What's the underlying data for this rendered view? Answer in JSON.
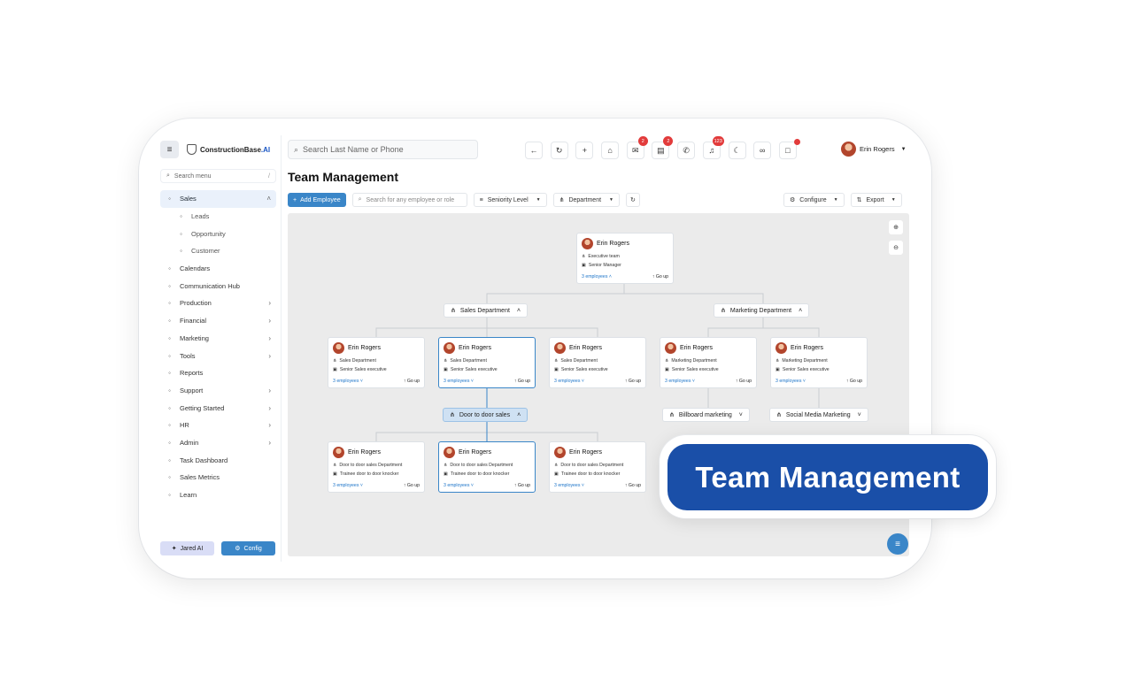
{
  "app": {
    "logo_text": "ConstructionBase",
    "logo_suffix": ".AI"
  },
  "sidebar": {
    "search_placeholder": "Search menu",
    "search_hint": "/",
    "items": [
      {
        "label": "Sales",
        "icon": "sales-icon",
        "active": true,
        "expanded": true
      },
      {
        "label": "Leads",
        "icon": "leads-icon",
        "sub": true
      },
      {
        "label": "Opportunity",
        "icon": "opportunity-icon",
        "sub": true
      },
      {
        "label": "Customer",
        "icon": "customer-icon",
        "sub": true
      },
      {
        "label": "Calendars",
        "icon": "calendar-icon"
      },
      {
        "label": "Communication Hub",
        "icon": "chat-icon"
      },
      {
        "label": "Production",
        "icon": "production-icon",
        "chevron": true
      },
      {
        "label": "Financial",
        "icon": "financial-icon",
        "chevron": true
      },
      {
        "label": "Marketing",
        "icon": "marketing-icon",
        "chevron": true
      },
      {
        "label": "Tools",
        "icon": "tools-icon",
        "chevron": true
      },
      {
        "label": "Reports",
        "icon": "reports-icon"
      },
      {
        "label": "Support",
        "icon": "support-icon",
        "chevron": true
      },
      {
        "label": "Getting Started",
        "icon": "rocket-icon",
        "chevron": true
      },
      {
        "label": "HR",
        "icon": "hr-icon",
        "chevron": true
      },
      {
        "label": "Admin",
        "icon": "admin-icon",
        "chevron": true
      },
      {
        "label": "Task Dashboard",
        "icon": "dashboard-icon"
      },
      {
        "label": "Sales Metrics",
        "icon": "metrics-icon"
      },
      {
        "label": "Learn",
        "icon": "learn-icon"
      }
    ],
    "jared_label": "Jared AI",
    "config_label": "Config"
  },
  "topbar": {
    "search_placeholder": "Search Last Name or Phone",
    "icons": [
      {
        "name": "back-arrow-icon",
        "glyph": "←"
      },
      {
        "name": "refresh-icon",
        "glyph": "↻"
      },
      {
        "name": "plus-icon",
        "glyph": "+"
      },
      {
        "name": "home-icon",
        "glyph": "⌂"
      },
      {
        "name": "mail-icon",
        "glyph": "✉",
        "badge": "2"
      },
      {
        "name": "message-icon",
        "glyph": "▤",
        "badge": "2"
      },
      {
        "name": "phone-icon",
        "glyph": "✆"
      },
      {
        "name": "bell-icon",
        "glyph": "♫",
        "badge": "123"
      },
      {
        "name": "moon-icon",
        "glyph": "☾"
      },
      {
        "name": "glasses-icon",
        "glyph": "∞"
      },
      {
        "name": "square-icon",
        "glyph": "□",
        "dot": true
      }
    ],
    "user_name": "Erin Rogers"
  },
  "page": {
    "title": "Team Management",
    "add_button": "Add Employee",
    "search_placeholder": "Search for any employee or role",
    "seniority_label": "Seniority Level",
    "department_label": "Department",
    "configure_label": "Configure",
    "export_label": "Export"
  },
  "org": {
    "root": {
      "name": "Erin Rogers",
      "dept": "Executive team",
      "role": "Senior Manager",
      "employees": "3 employees",
      "go": "Go up"
    },
    "departments": [
      {
        "label": "Sales Department"
      },
      {
        "label": "Marketing Department"
      },
      {
        "label": "Door to door sales"
      },
      {
        "label": "Billboard marketing"
      },
      {
        "label": "Social Media Marketing"
      }
    ],
    "row1": [
      {
        "name": "Erin Rogers",
        "dept": "Sales Department",
        "role": "Senior Sales executive",
        "employees": "3 employees",
        "go": "Go up"
      },
      {
        "name": "Erin Rogers",
        "dept": "Sales Department",
        "role": "Senior Sales executive",
        "employees": "3 employees",
        "go": "Go up"
      },
      {
        "name": "Erin Rogers",
        "dept": "Sales Department",
        "role": "Senior Sales executive",
        "employees": "3 employees",
        "go": "Go up"
      },
      {
        "name": "Erin Rogers",
        "dept": "Marketing Department",
        "role": "Senior Sales executive",
        "employees": "3 employees",
        "go": "Go up"
      },
      {
        "name": "Erin Rogers",
        "dept": "Marketing Department",
        "role": "Senior Sales executive",
        "employees": "3 employees",
        "go": "Go up"
      }
    ],
    "row2": [
      {
        "name": "Erin Rogers",
        "dept": "Door to door sales Department",
        "role": "Trainee door to door knocker",
        "employees": "3 employees",
        "go": "Go up"
      },
      {
        "name": "Erin Rogers",
        "dept": "Door to door sales Department",
        "role": "Trainee door to door knocker",
        "employees": "3 employees",
        "go": "Go up"
      },
      {
        "name": "Erin Rogers",
        "dept": "Door to door sales Department",
        "role": "Trainee door to door knocker",
        "employees": "3 employees",
        "go": "Go up"
      }
    ]
  },
  "callout": {
    "text": "Team Management"
  },
  "colors": {
    "accent": "#3a86c8",
    "callout": "#1a4fa8",
    "badge": "#e23b3b"
  }
}
